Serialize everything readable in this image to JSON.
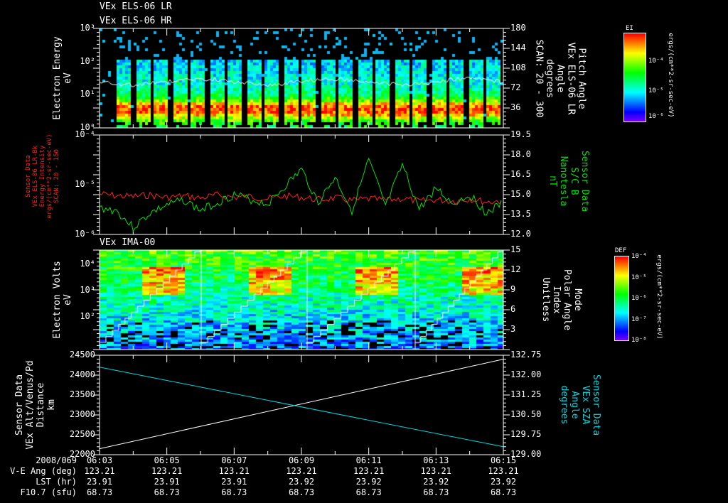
{
  "titles": {
    "p1a": "VEx ELS-06 LR",
    "p1b": "VEx ELS-06 HR",
    "p3": "VEx IMA-00"
  },
  "panel1": {
    "ylabel": [
      "Electron Energy",
      "eV"
    ],
    "yticks": [
      "10³",
      "10²",
      "10¹",
      "10⁰"
    ],
    "rticks": [
      "180",
      "144",
      "108",
      "72",
      "36"
    ],
    "rlabel": [
      "Pitch Angle",
      "VEx ELS-06 LR",
      "Angle",
      "degrees",
      "SCAN: 20 - 300"
    ],
    "colorbar": {
      "title": "EI",
      "ticks": [
        "10⁻⁴",
        "10⁻⁵",
        "10⁻⁶"
      ],
      "unit": "ergs/(cm**2-sr-sec-eV)"
    }
  },
  "panel2": {
    "ylabel": [
      "Sensor Data",
      "VEx ELS-06 LR-Bk",
      "Energy Intensity",
      "ergs/(cm**2-sr-sec-eV)",
      "SCAN: 20 - 150"
    ],
    "yticks": [
      "10⁻⁴",
      "10⁻⁵",
      "10⁻⁶"
    ],
    "rticks": [
      "19.5",
      "18.0",
      "16.5",
      "15.0",
      "13.5",
      "12.0"
    ],
    "rlabel": [
      "Sensor Data",
      "S/C B",
      "Nanotesla",
      "nT"
    ]
  },
  "panel3": {
    "ylabel": [
      "Electron Volts",
      "eV"
    ],
    "yticks": [
      "10⁴",
      "10³",
      "10²"
    ],
    "rticks": [
      "15",
      "12",
      "9",
      "6",
      "3"
    ],
    "rlabel": [
      "Mode",
      "Polar Angle",
      "Index",
      "Unitless"
    ],
    "colorbar": {
      "title": "DEF",
      "ticks": [
        "10⁻⁴",
        "10⁻⁵",
        "10⁻⁶",
        "10⁻⁷",
        "10⁻⁸"
      ],
      "unit": "ergs/(cm**2-sr-sec-eV)"
    }
  },
  "panel4": {
    "ylabel": [
      "Sensor Data",
      "VEx Alt/Venus/Pd",
      "Distance",
      "km"
    ],
    "yticks": [
      "24500",
      "24000",
      "23500",
      "23000",
      "22500",
      "22000"
    ],
    "rticks": [
      "132.75",
      "132.00",
      "131.25",
      "130.50",
      "129.75",
      "129.00"
    ],
    "rlabel": [
      "Sensor Data",
      "VEx SZA",
      "Angle",
      "degrees"
    ]
  },
  "footer": {
    "labels": [
      "2008/069",
      "V-E Ang (deg)",
      "LST (hr)",
      "F10.7 (sfu)"
    ],
    "columns": [
      {
        "time": "06:03",
        "ve": "123.21",
        "lst": "23.91",
        "f107": "68.73"
      },
      {
        "time": "06:05",
        "ve": "123.21",
        "lst": "23.91",
        "f107": "68.73"
      },
      {
        "time": "06:07",
        "ve": "123.21",
        "lst": "23.91",
        "f107": "68.73"
      },
      {
        "time": "06:09",
        "ve": "123.21",
        "lst": "23.92",
        "f107": "68.73"
      },
      {
        "time": "06:11",
        "ve": "123.21",
        "lst": "23.92",
        "f107": "68.73"
      },
      {
        "time": "06:13",
        "ve": "123.21",
        "lst": "23.92",
        "f107": "68.73"
      },
      {
        "time": "06:15",
        "ve": "123.21",
        "lst": "23.92",
        "f107": "68.73"
      }
    ]
  },
  "colors": {
    "red": "#ff2020",
    "green": "#00e000",
    "cyan": "#00d8e0",
    "white": "#ffffff"
  },
  "chart_data": [
    {
      "type": "heatmap",
      "title": "VEx ELS-06 LR / HR",
      "ylabel": "Electron Energy (eV)",
      "ylim": [
        1,
        1000
      ],
      "yscale": "log",
      "xlim": [
        "06:03",
        "06:15"
      ]
    },
    {
      "type": "line",
      "ylabel": "Energy Intensity",
      "ylim": [
        1e-06,
        0.0001
      ],
      "yscale": "log",
      "x": [
        3,
        3.5,
        4,
        4.5,
        5,
        5.5,
        6,
        6.5,
        7,
        7.5,
        8,
        8.5,
        9,
        9.5,
        10,
        10.5,
        11,
        11.5,
        12,
        12.5,
        13,
        13.5,
        14,
        14.5,
        15
      ],
      "series": [
        {
          "name": "VEx ELS-06 LR-Bk",
          "axis": "left",
          "values": [
            6.5e-06,
            6e-06,
            5.8e-06,
            6.2e-06,
            5.5e-06,
            6e-06,
            5.4e-06,
            6.2e-06,
            5.6e-06,
            5.8e-06,
            5.2e-06,
            5.9e-06,
            5.6e-06,
            5e-06,
            5.4e-06,
            4.8e-06,
            5.2e-06,
            4.9e-06,
            5.3e-06,
            4.6e-06,
            5e-06,
            4.7e-06,
            5.2e-06,
            4.5e-06,
            4.8e-06
          ]
        },
        {
          "name": "S/C B (nT)",
          "axis": "right",
          "ylim": [
            12,
            19.5
          ],
          "values": [
            14.0,
            13.8,
            12.5,
            13.6,
            14.2,
            14.6,
            13.8,
            14.4,
            15.0,
            14.6,
            14.3,
            15.6,
            16.9,
            14.4,
            16.3,
            13.8,
            17.6,
            14.1,
            17.2,
            13.9,
            15.5,
            14.3,
            15.0,
            13.6,
            14.4
          ]
        }
      ]
    },
    {
      "type": "heatmap",
      "title": "VEx IMA-00",
      "ylabel": "Electron Volts (eV)",
      "ylim": [
        10,
        40000
      ],
      "yscale": "log"
    },
    {
      "type": "line",
      "x": [
        "06:03",
        "06:15"
      ],
      "series": [
        {
          "name": "VEx Alt/Venus/Pd Distance (km)",
          "axis": "left",
          "ylim": [
            22000,
            24500
          ],
          "values": [
            22150,
            24400
          ]
        },
        {
          "name": "VEx SZA Angle (deg)",
          "axis": "right",
          "ylim": [
            129.0,
            132.75
          ],
          "values": [
            132.3,
            129.3
          ]
        }
      ]
    }
  ]
}
